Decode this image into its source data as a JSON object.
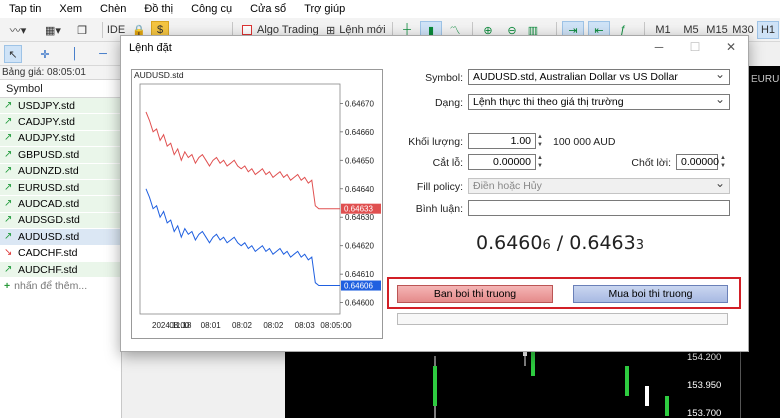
{
  "menu": [
    "Tap tin",
    "Xem",
    "Chèn",
    "Đồ thị",
    "Công cụ",
    "Cửa sổ",
    "Trợ giúp"
  ],
  "toolbar": {
    "ide_label": "IDE",
    "algo_label": "Algo Trading",
    "new_order_label": "Lệnh mới",
    "timeframes": [
      "M1",
      "M5",
      "M15",
      "M30",
      "H1"
    ]
  },
  "market_watch": {
    "header": "Bảng giá: 08:05:01",
    "column": "Symbol",
    "symbols": [
      {
        "name": "USDJPY.std",
        "dir": "up"
      },
      {
        "name": "CADJPY.std",
        "dir": "up"
      },
      {
        "name": "AUDJPY.std",
        "dir": "up"
      },
      {
        "name": "GBPUSD.std",
        "dir": "up"
      },
      {
        "name": "AUDNZD.std",
        "dir": "up"
      },
      {
        "name": "EURUSD.std",
        "dir": "up"
      },
      {
        "name": "AUDCAD.std",
        "dir": "up"
      },
      {
        "name": "AUDSGD.std",
        "dir": "up"
      },
      {
        "name": "AUDUSD.std",
        "dir": "up"
      },
      {
        "name": "CADCHF.std",
        "dir": "down"
      },
      {
        "name": "AUDCHF.std",
        "dir": "up"
      }
    ],
    "add_label": "nhấn để thêm..."
  },
  "background": {
    "prices": [
      "154.200",
      "153.950",
      "153.700"
    ],
    "tab_label": "EURU"
  },
  "dialog": {
    "title": "Lệnh đặt",
    "symbol_label": "Symbol:",
    "symbol_value": "AUDUSD.std, Australian Dollar vs US Dollar",
    "type_label": "Dạng:",
    "type_value": "Lệnh thực thi theo giá thị trường",
    "volume_label": "Khối lượng:",
    "volume_value": "1.00",
    "volume_note": "100 000 AUD",
    "sl_label": "Cắt lỗ:",
    "sl_value": "0.00000",
    "tp_label": "Chốt lời:",
    "tp_value": "0.00000",
    "fill_label": "Fill policy:",
    "fill_value": "Điền hoặc Hủy",
    "comment_label": "Bình luận:",
    "comment_value": "",
    "bid_main": "0.6460",
    "bid_small": "6",
    "separator": " / ",
    "ask_main": "0.6463",
    "ask_small": "3",
    "sell_label": "Ban boi thi truong",
    "buy_label": "Mua boi thi truong"
  },
  "chart_data": {
    "type": "line",
    "title": "AUDUSD.std",
    "x_ticks": [
      "2024.11.18",
      "08:00",
      "08:01",
      "08:02",
      "08:02",
      "08:03",
      "08:05:00"
    ],
    "y_ticks": [
      "0.64670",
      "0.64660",
      "0.64650",
      "0.64640",
      "0.64630",
      "0.64620",
      "0.64610",
      "0.64600"
    ],
    "ylim": [
      0.64596,
      0.64674
    ],
    "series": [
      {
        "name": "",
        "color": "#e05050",
        "last_label": "0.64633",
        "values": [
          0.64667,
          0.64664,
          0.6466,
          0.64661,
          0.64657,
          0.64659,
          0.64655,
          0.64656,
          0.64652,
          0.64654,
          0.6465,
          0.64653,
          0.64651,
          0.64652,
          0.64649,
          0.64651,
          0.64652,
          0.6465,
          0.64648,
          0.6465,
          0.64651,
          0.64649,
          0.6465,
          0.64648,
          0.64649,
          0.6465,
          0.64648,
          0.64647,
          0.64648,
          0.64646,
          0.64647,
          0.64645,
          0.64646,
          0.64647,
          0.64645,
          0.64646,
          0.64644,
          0.64645,
          0.64646,
          0.64644,
          0.64645,
          0.64643,
          0.64644,
          0.64645,
          0.64643,
          0.64644,
          0.64642,
          0.64643,
          0.64634,
          0.64633,
          0.64633,
          0.64633,
          0.64633,
          0.64633,
          0.64633,
          0.64633
        ]
      },
      {
        "name": "",
        "color": "#2060e0",
        "last_label": "0.64606",
        "values": [
          0.6464,
          0.64637,
          0.64633,
          0.64634,
          0.6463,
          0.64632,
          0.64628,
          0.64629,
          0.64625,
          0.64627,
          0.64623,
          0.64626,
          0.64624,
          0.64625,
          0.64622,
          0.64624,
          0.64625,
          0.64623,
          0.64621,
          0.64623,
          0.64624,
          0.64622,
          0.64623,
          0.64621,
          0.64622,
          0.64623,
          0.64621,
          0.6462,
          0.64621,
          0.64619,
          0.6462,
          0.64618,
          0.64619,
          0.6462,
          0.64618,
          0.64619,
          0.64617,
          0.64618,
          0.64619,
          0.64617,
          0.64618,
          0.64616,
          0.64617,
          0.64618,
          0.64616,
          0.64617,
          0.64615,
          0.64616,
          0.64607,
          0.64606,
          0.64606,
          0.64606,
          0.64606,
          0.64606,
          0.64606,
          0.64606
        ]
      }
    ]
  }
}
